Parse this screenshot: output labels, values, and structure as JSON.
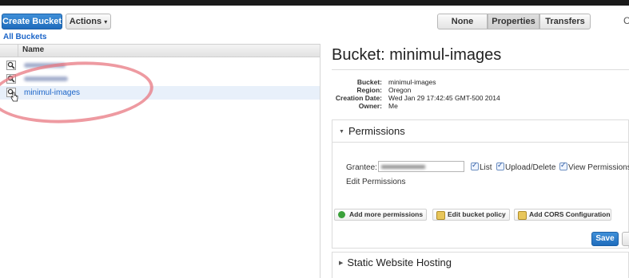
{
  "toolbar": {
    "create_bucket": "Create Bucket",
    "actions": "Actions",
    "actions_caret": "▾",
    "view_tabs": [
      "None",
      "Properties",
      "Transfers"
    ],
    "active_tab": "Properties",
    "edge_glyph": "C"
  },
  "breadcrumb": "All Buckets",
  "bucket_list": {
    "column_header": "Name",
    "buckets": [
      {
        "name": "",
        "redacted": true
      },
      {
        "name": "",
        "redacted": true
      },
      {
        "name": "minimul-images",
        "redacted": false,
        "selected": true
      }
    ]
  },
  "detail": {
    "title": "Bucket: minimul-images",
    "fields": [
      {
        "key": "Bucket:",
        "value": "minimul-images"
      },
      {
        "key": "Region:",
        "value": "Oregon"
      },
      {
        "key": "Creation Date:",
        "value": "Wed Jan 29 17:42:45 GMT-500 2014"
      },
      {
        "key": "Owner:",
        "value": "Me"
      }
    ],
    "permissions": {
      "heading": "Permissions",
      "expanded": true,
      "grantee_label": "Grantee:",
      "checkboxes": [
        {
          "label": "List",
          "checked": true
        },
        {
          "label": "Upload/Delete",
          "checked": true
        },
        {
          "label": "View Permissions",
          "checked": true
        }
      ],
      "edit_label": "Edit Permissions",
      "actions": [
        {
          "label": "Add more permissions",
          "icon": "add-icon"
        },
        {
          "label": "Edit bucket policy",
          "icon": "policy-icon"
        },
        {
          "label": "Add CORS Configuration",
          "icon": "cors-icon"
        }
      ],
      "save": "Save"
    },
    "static_hosting": {
      "heading": "Static Website Hosting",
      "expanded": false
    }
  },
  "colors": {
    "primary": "#1f6cbc",
    "link": "#1a64c8",
    "annotation": "#e87882"
  }
}
